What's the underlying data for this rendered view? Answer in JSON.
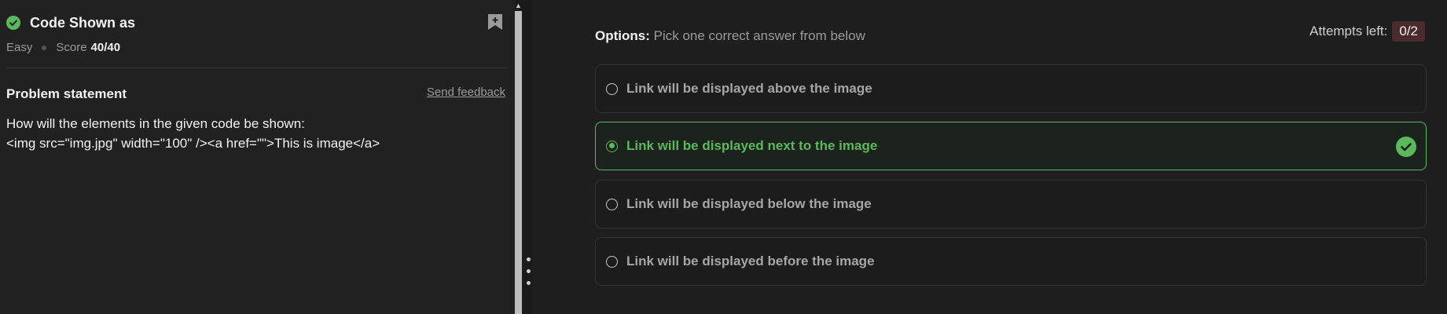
{
  "question": {
    "title": "Code Shown as",
    "difficulty": "Easy",
    "score_label": "Score",
    "score_value": "40/40",
    "status_icon": "check-circle-icon",
    "status_color": "#5cb85c"
  },
  "problem": {
    "heading": "Problem statement",
    "feedback_link": "Send feedback",
    "line1": "How will the elements in the given code be shown:",
    "line2": "<img src=\"img.jpg\" width=\"100\" /><a href=\"\">This is image</a>"
  },
  "options_header": {
    "label": "Options:",
    "hint": "Pick one correct answer from below"
  },
  "attempts": {
    "label": "Attempts left:",
    "value": "0/2"
  },
  "options": [
    {
      "label": "Link will be displayed above the image",
      "selected": false
    },
    {
      "label": "Link will be displayed next to the image",
      "selected": true,
      "correct": true
    },
    {
      "label": "Link will be displayed below the image",
      "selected": false
    },
    {
      "label": "Link will be displayed before the image",
      "selected": false
    }
  ],
  "colors": {
    "accent_green": "#5cb85c",
    "badge_bg": "#4a2a2a"
  }
}
